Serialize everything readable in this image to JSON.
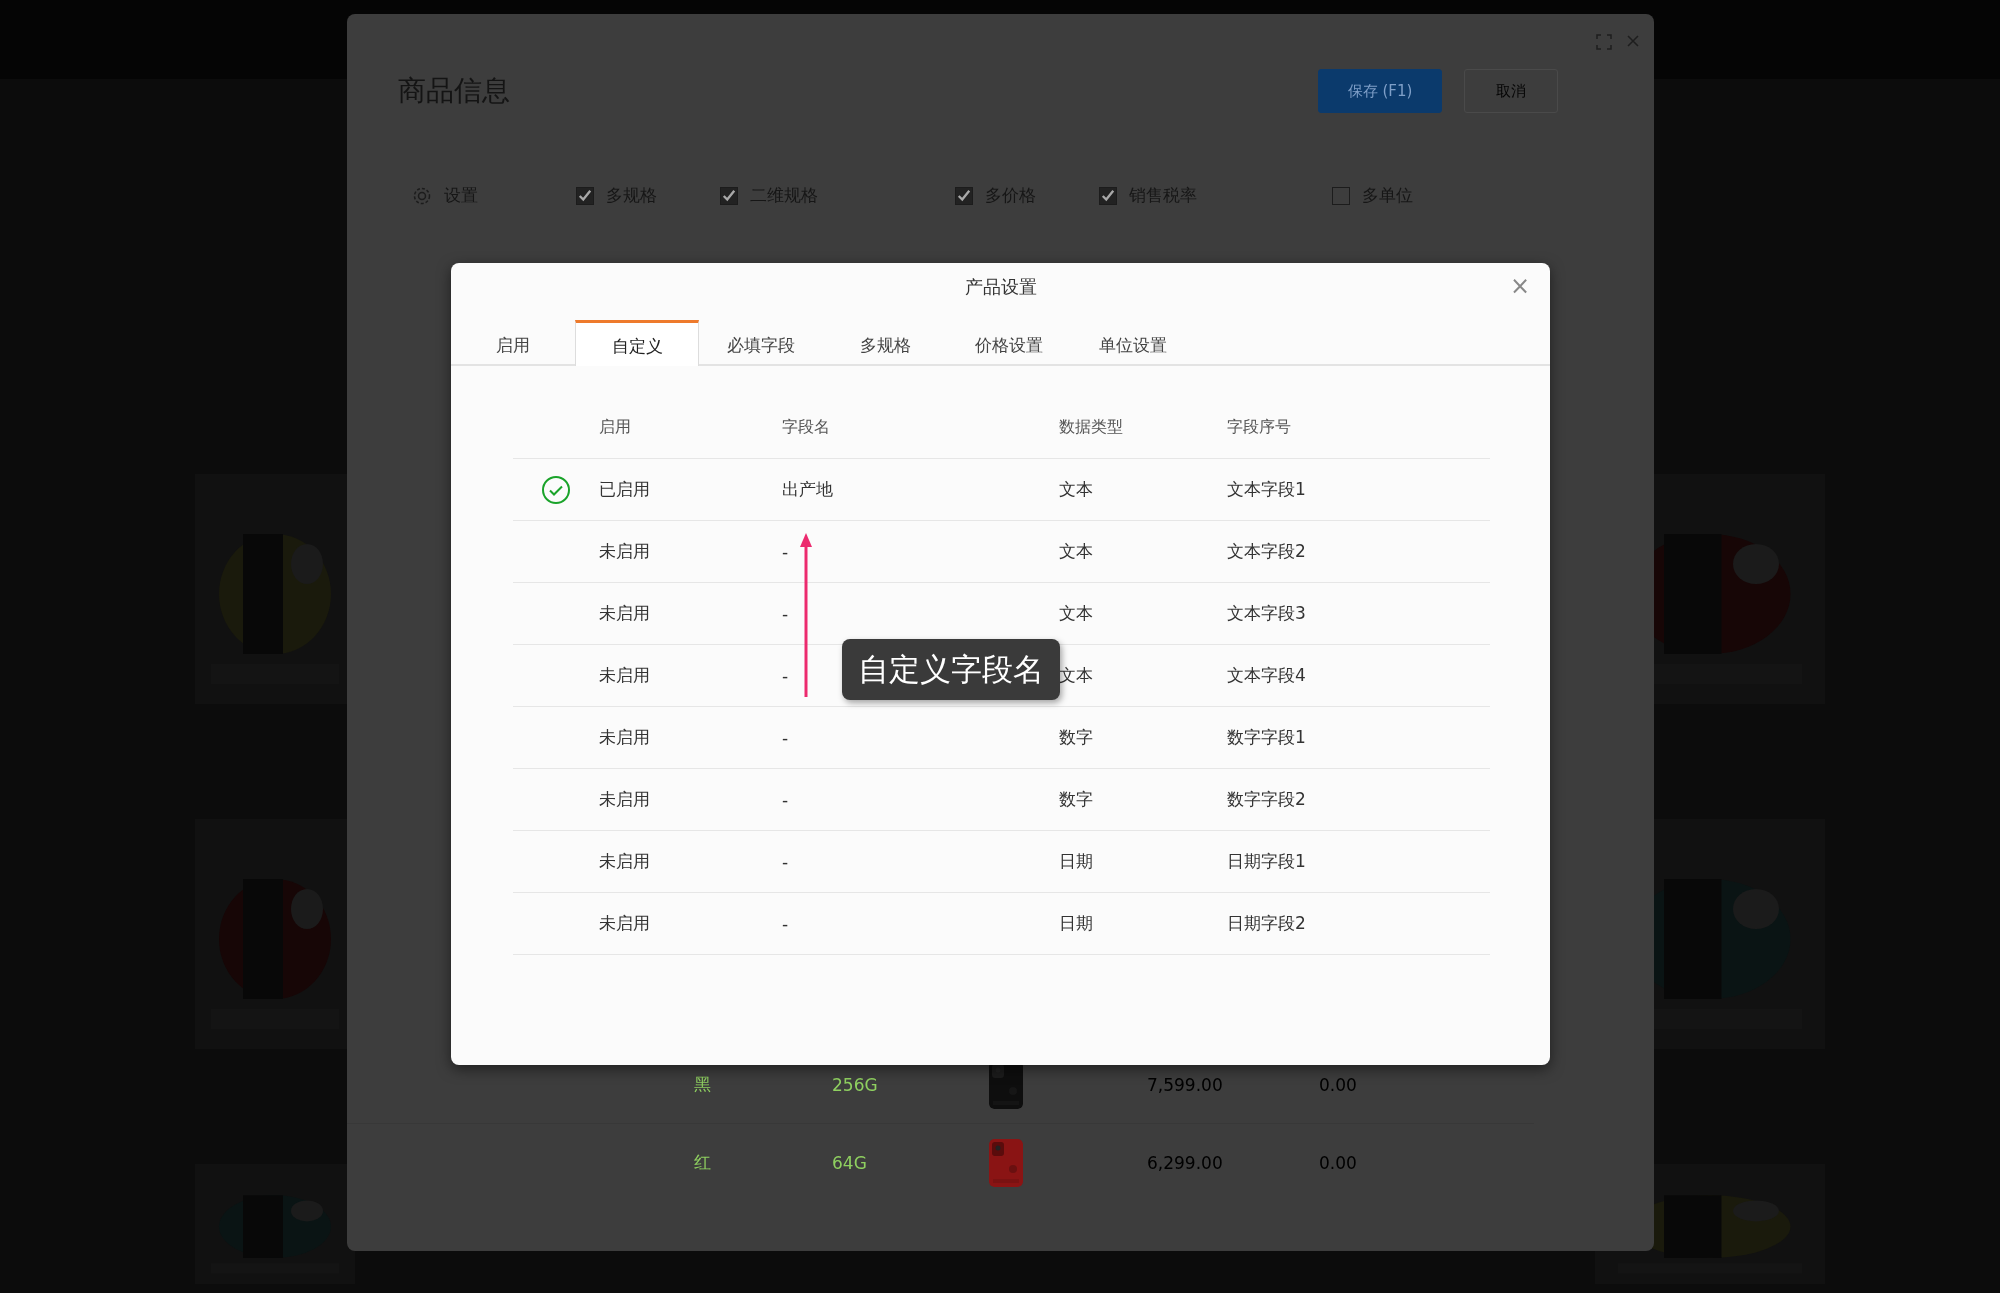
{
  "product_modal": {
    "title": "商品信息",
    "buttons": [
      {
        "label": "保存 (F1)",
        "kind": "primary"
      },
      {
        "label": "取消",
        "kind": "secondary"
      }
    ],
    "options": [
      {
        "label": "设置",
        "kind": "settings"
      },
      {
        "label": "多规格",
        "kind": "checkbox",
        "checked": true
      },
      {
        "label": "二维规格",
        "kind": "checkbox",
        "checked": true
      },
      {
        "label": "多价格",
        "kind": "checkbox",
        "checked": true
      },
      {
        "label": "销售税率",
        "kind": "checkbox",
        "checked": true
      },
      {
        "label": "多单位",
        "kind": "checkbox",
        "checked": false
      }
    ],
    "variants": [
      {
        "spec_1": "黑",
        "storage": "256G",
        "price": "7,599.00",
        "tax": "0.00"
      },
      {
        "spec_1": "红",
        "storage": "64G",
        "price": "6,299.00",
        "tax": "0.00"
      }
    ]
  },
  "dialog": {
    "title": "产品设置",
    "close": "×",
    "tabs": [
      {
        "label": "启用",
        "selected": false
      },
      {
        "label": "自定义",
        "selected": true
      },
      {
        "label": "必填字段",
        "selected": false
      },
      {
        "label": "多规格",
        "selected": false
      },
      {
        "label": "价格设置",
        "selected": false
      },
      {
        "label": "单位设置",
        "selected": false
      }
    ],
    "columns": [
      "启用",
      "字段名",
      "数据类型",
      "字段序号"
    ],
    "rows": [
      {
        "enabled": true,
        "status": "已启用",
        "name": "出产地",
        "type": "文本",
        "field": "文本字段1"
      },
      {
        "enabled": false,
        "status": "未启用",
        "name": "-",
        "type": "文本",
        "field": "文本字段2"
      },
      {
        "enabled": false,
        "status": "未启用",
        "name": "-",
        "type": "文本",
        "field": "文本字段3"
      },
      {
        "enabled": false,
        "status": "未启用",
        "name": "-",
        "type": "文本",
        "field": "文本字段4"
      },
      {
        "enabled": false,
        "status": "未启用",
        "name": "-",
        "type": "数字",
        "field": "数字字段1"
      },
      {
        "enabled": false,
        "status": "未启用",
        "name": "-",
        "type": "数字",
        "field": "数字字段2"
      },
      {
        "enabled": false,
        "status": "未启用",
        "name": "-",
        "type": "日期",
        "field": "日期字段1"
      },
      {
        "enabled": false,
        "status": "未启用",
        "name": "-",
        "type": "日期",
        "field": "日期字段2"
      }
    ],
    "annotation": "自定义字段名"
  }
}
